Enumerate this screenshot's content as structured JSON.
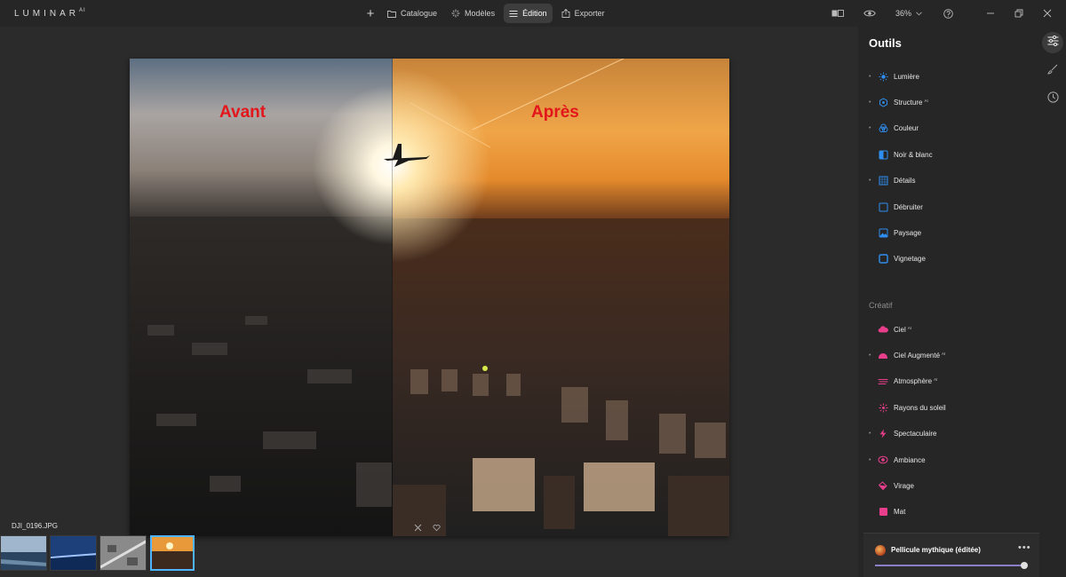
{
  "app": {
    "logo_text": "LUMINAR",
    "logo_sup": "AI"
  },
  "topbar": {
    "nav": [
      {
        "label": "Catalogue",
        "icon": "folder-icon"
      },
      {
        "label": "Modèles",
        "icon": "sparkle-icon"
      },
      {
        "label": "Édition",
        "icon": "sliders-icon",
        "active": true
      },
      {
        "label": "Exporter",
        "icon": "export-icon"
      }
    ],
    "zoom": "36%"
  },
  "photo": {
    "before_label": "Avant",
    "after_label": "Après",
    "label_color": "#e3161b",
    "filename": "DJI_0196.JPG"
  },
  "filmstrip": {
    "thumbnails": [
      {
        "name": "aerial-city-river",
        "active": false
      },
      {
        "name": "blue-water-landscape",
        "active": false
      },
      {
        "name": "bw-aerial-city",
        "active": false
      },
      {
        "name": "sunset-aerial-city",
        "active": true
      }
    ]
  },
  "sidebar": {
    "title": "Outils",
    "section_creative": "Créatif",
    "essential_tools": [
      {
        "label": "Lumière",
        "ai": "",
        "dot": true,
        "icon": "sun-icon",
        "color": "#2f8ff0"
      },
      {
        "label": "Structure",
        "ai": "AI",
        "dot": true,
        "icon": "structure-icon",
        "color": "#2f8ff0"
      },
      {
        "label": "Couleur",
        "ai": "",
        "dot": true,
        "icon": "color-circles-icon",
        "color": "#2f8ff0"
      },
      {
        "label": "Noir & blanc",
        "ai": "",
        "dot": false,
        "icon": "half-square-icon",
        "color": "#2f8ff0"
      },
      {
        "label": "Détails",
        "ai": "",
        "dot": true,
        "icon": "details-grid-icon",
        "color": "#2f8ff0"
      },
      {
        "label": "Débruiter",
        "ai": "",
        "dot": false,
        "icon": "denoise-square-icon",
        "color": "#2f8ff0"
      },
      {
        "label": "Paysage",
        "ai": "",
        "dot": false,
        "icon": "landscape-icon",
        "color": "#2f8ff0"
      },
      {
        "label": "Vignetage",
        "ai": "",
        "dot": false,
        "icon": "vignette-icon",
        "color": "#2f8ff0"
      }
    ],
    "creative_tools": [
      {
        "label": "Ciel",
        "ai": "AI",
        "dot": false,
        "icon": "cloud-icon",
        "color": "#e83e8c"
      },
      {
        "label": "Ciel Augmenté",
        "ai": "AI",
        "dot": true,
        "icon": "augmented-sky-icon",
        "color": "#e83e8c"
      },
      {
        "label": "Atmosphère",
        "ai": "AI",
        "dot": false,
        "icon": "atmosphere-icon",
        "color": "#e83e8c"
      },
      {
        "label": "Rayons du soleil",
        "ai": "",
        "dot": false,
        "icon": "sunrays-icon",
        "color": "#e83e8c"
      },
      {
        "label": "Spectaculaire",
        "ai": "",
        "dot": true,
        "icon": "lightning-icon",
        "color": "#e83e8c"
      },
      {
        "label": "Ambiance",
        "ai": "",
        "dot": true,
        "icon": "mood-icon",
        "color": "#e83e8c"
      },
      {
        "label": "Virage",
        "ai": "",
        "dot": false,
        "icon": "toning-bucket-icon",
        "color": "#e83e8c"
      },
      {
        "label": "Mat",
        "ai": "",
        "dot": false,
        "icon": "matte-square-icon",
        "color": "#e83e8c"
      }
    ]
  },
  "preset": {
    "name": "Pellicule mythique (éditée)",
    "more": "•••",
    "amount": 1.0
  }
}
